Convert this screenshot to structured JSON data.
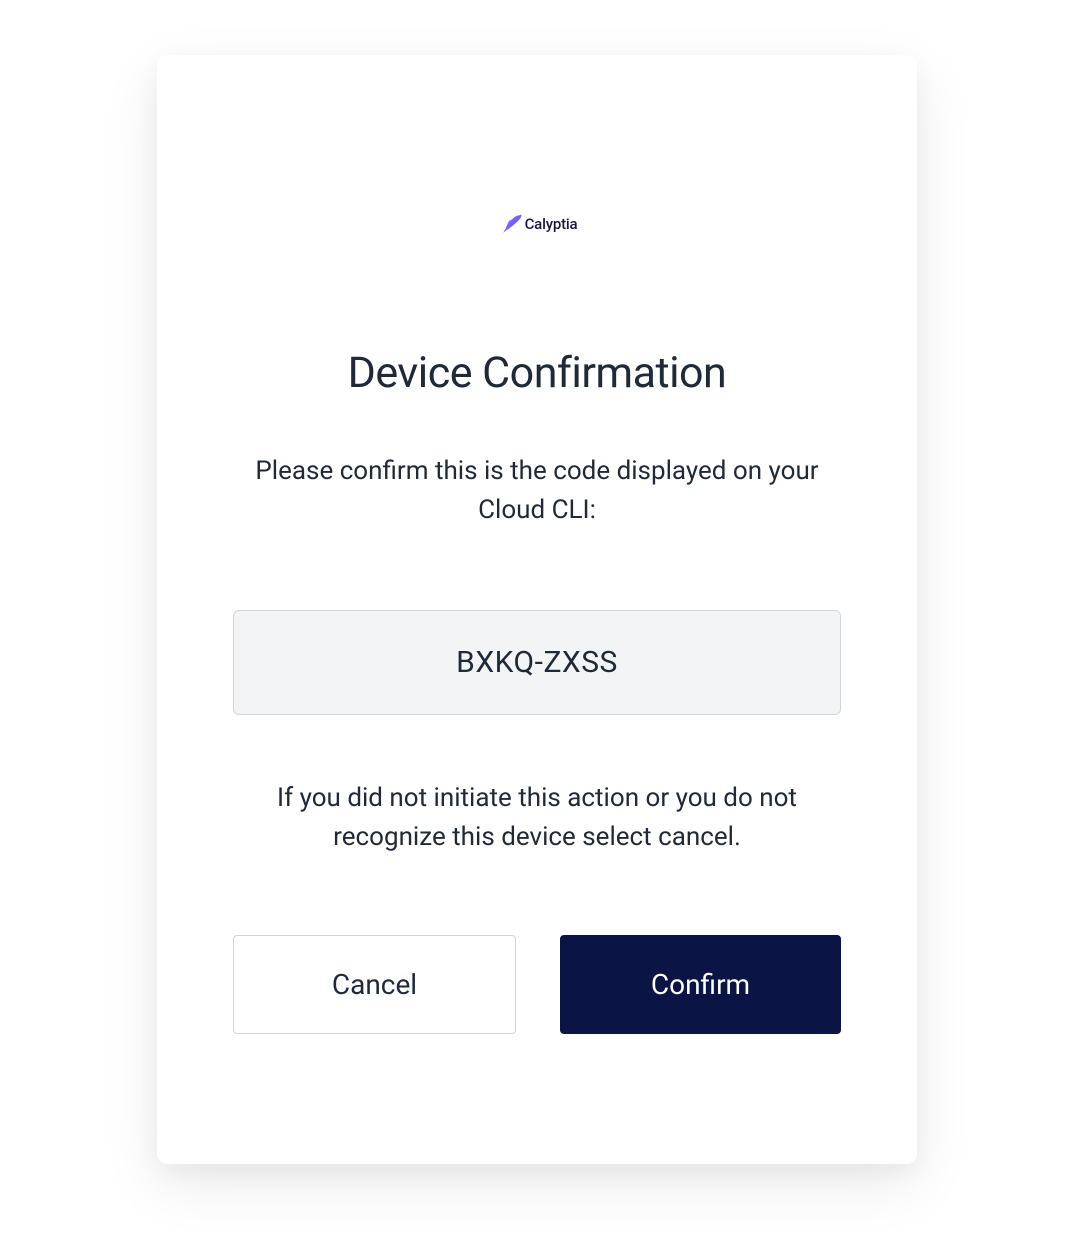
{
  "brand": {
    "name": "Calyptia"
  },
  "title": "Device Confirmation",
  "instruction": "Please confirm this is the code displayed on your Cloud CLI:",
  "code": "BXKQ-ZXSS",
  "warning": "If you did not initiate this action or you do not recognize this device select cancel.",
  "buttons": {
    "cancel": "Cancel",
    "confirm": "Confirm"
  }
}
